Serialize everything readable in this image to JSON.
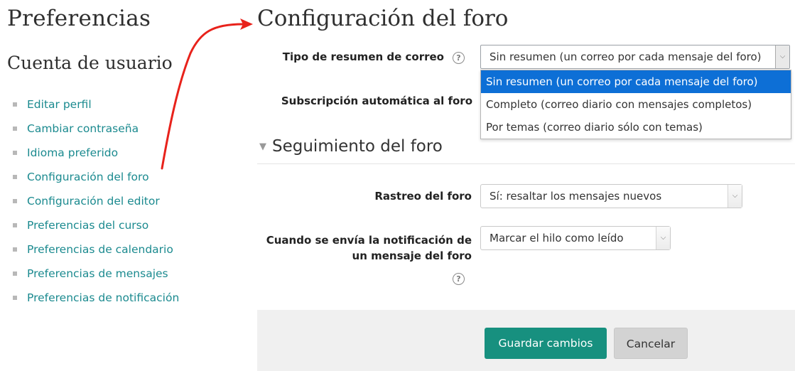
{
  "left": {
    "title": "Preferencias",
    "subtitle": "Cuenta de usuario",
    "links": [
      "Editar perfil",
      "Cambiar contraseña",
      "Idioma preferido",
      "Configuración del foro",
      "Configuración del editor",
      "Preferencias del curso",
      "Preferencias de calendario",
      "Preferencias de mensajes",
      "Preferencias de notificación"
    ]
  },
  "main": {
    "title": "Configuración del foro",
    "digest": {
      "label": "Tipo de resumen de correo",
      "selected": "Sin resumen (un correo por cada mensaje del foro)",
      "options": [
        "Sin resumen (un correo por cada mensaje del foro)",
        "Completo (correo diario con mensajes completos)",
        "Por temas (correo diario sólo con temas)"
      ]
    },
    "autosubscribe": {
      "label": "Subscripción automática al foro"
    },
    "section": "Seguimiento del foro",
    "tracking": {
      "label": "Rastreo del foro",
      "selected": "Sí: resaltar los mensajes nuevos"
    },
    "notification": {
      "label_line1": "Cuando se envía la notificación de",
      "label_line2": "un mensaje del foro",
      "selected": "Marcar el hilo como leído"
    },
    "buttons": {
      "save": "Guardar cambios",
      "cancel": "Cancelar"
    }
  },
  "icons": {
    "help": "question-circle-icon",
    "dropdown": "chevron-down-icon",
    "section": "collapse-triangle-icon",
    "annotation": "red-arrow-annotation"
  },
  "colors": {
    "link": "#1b8a8f",
    "primary_button": "#17907f",
    "selected_option": "#0d6fd6",
    "annotation": "#e8221b"
  }
}
